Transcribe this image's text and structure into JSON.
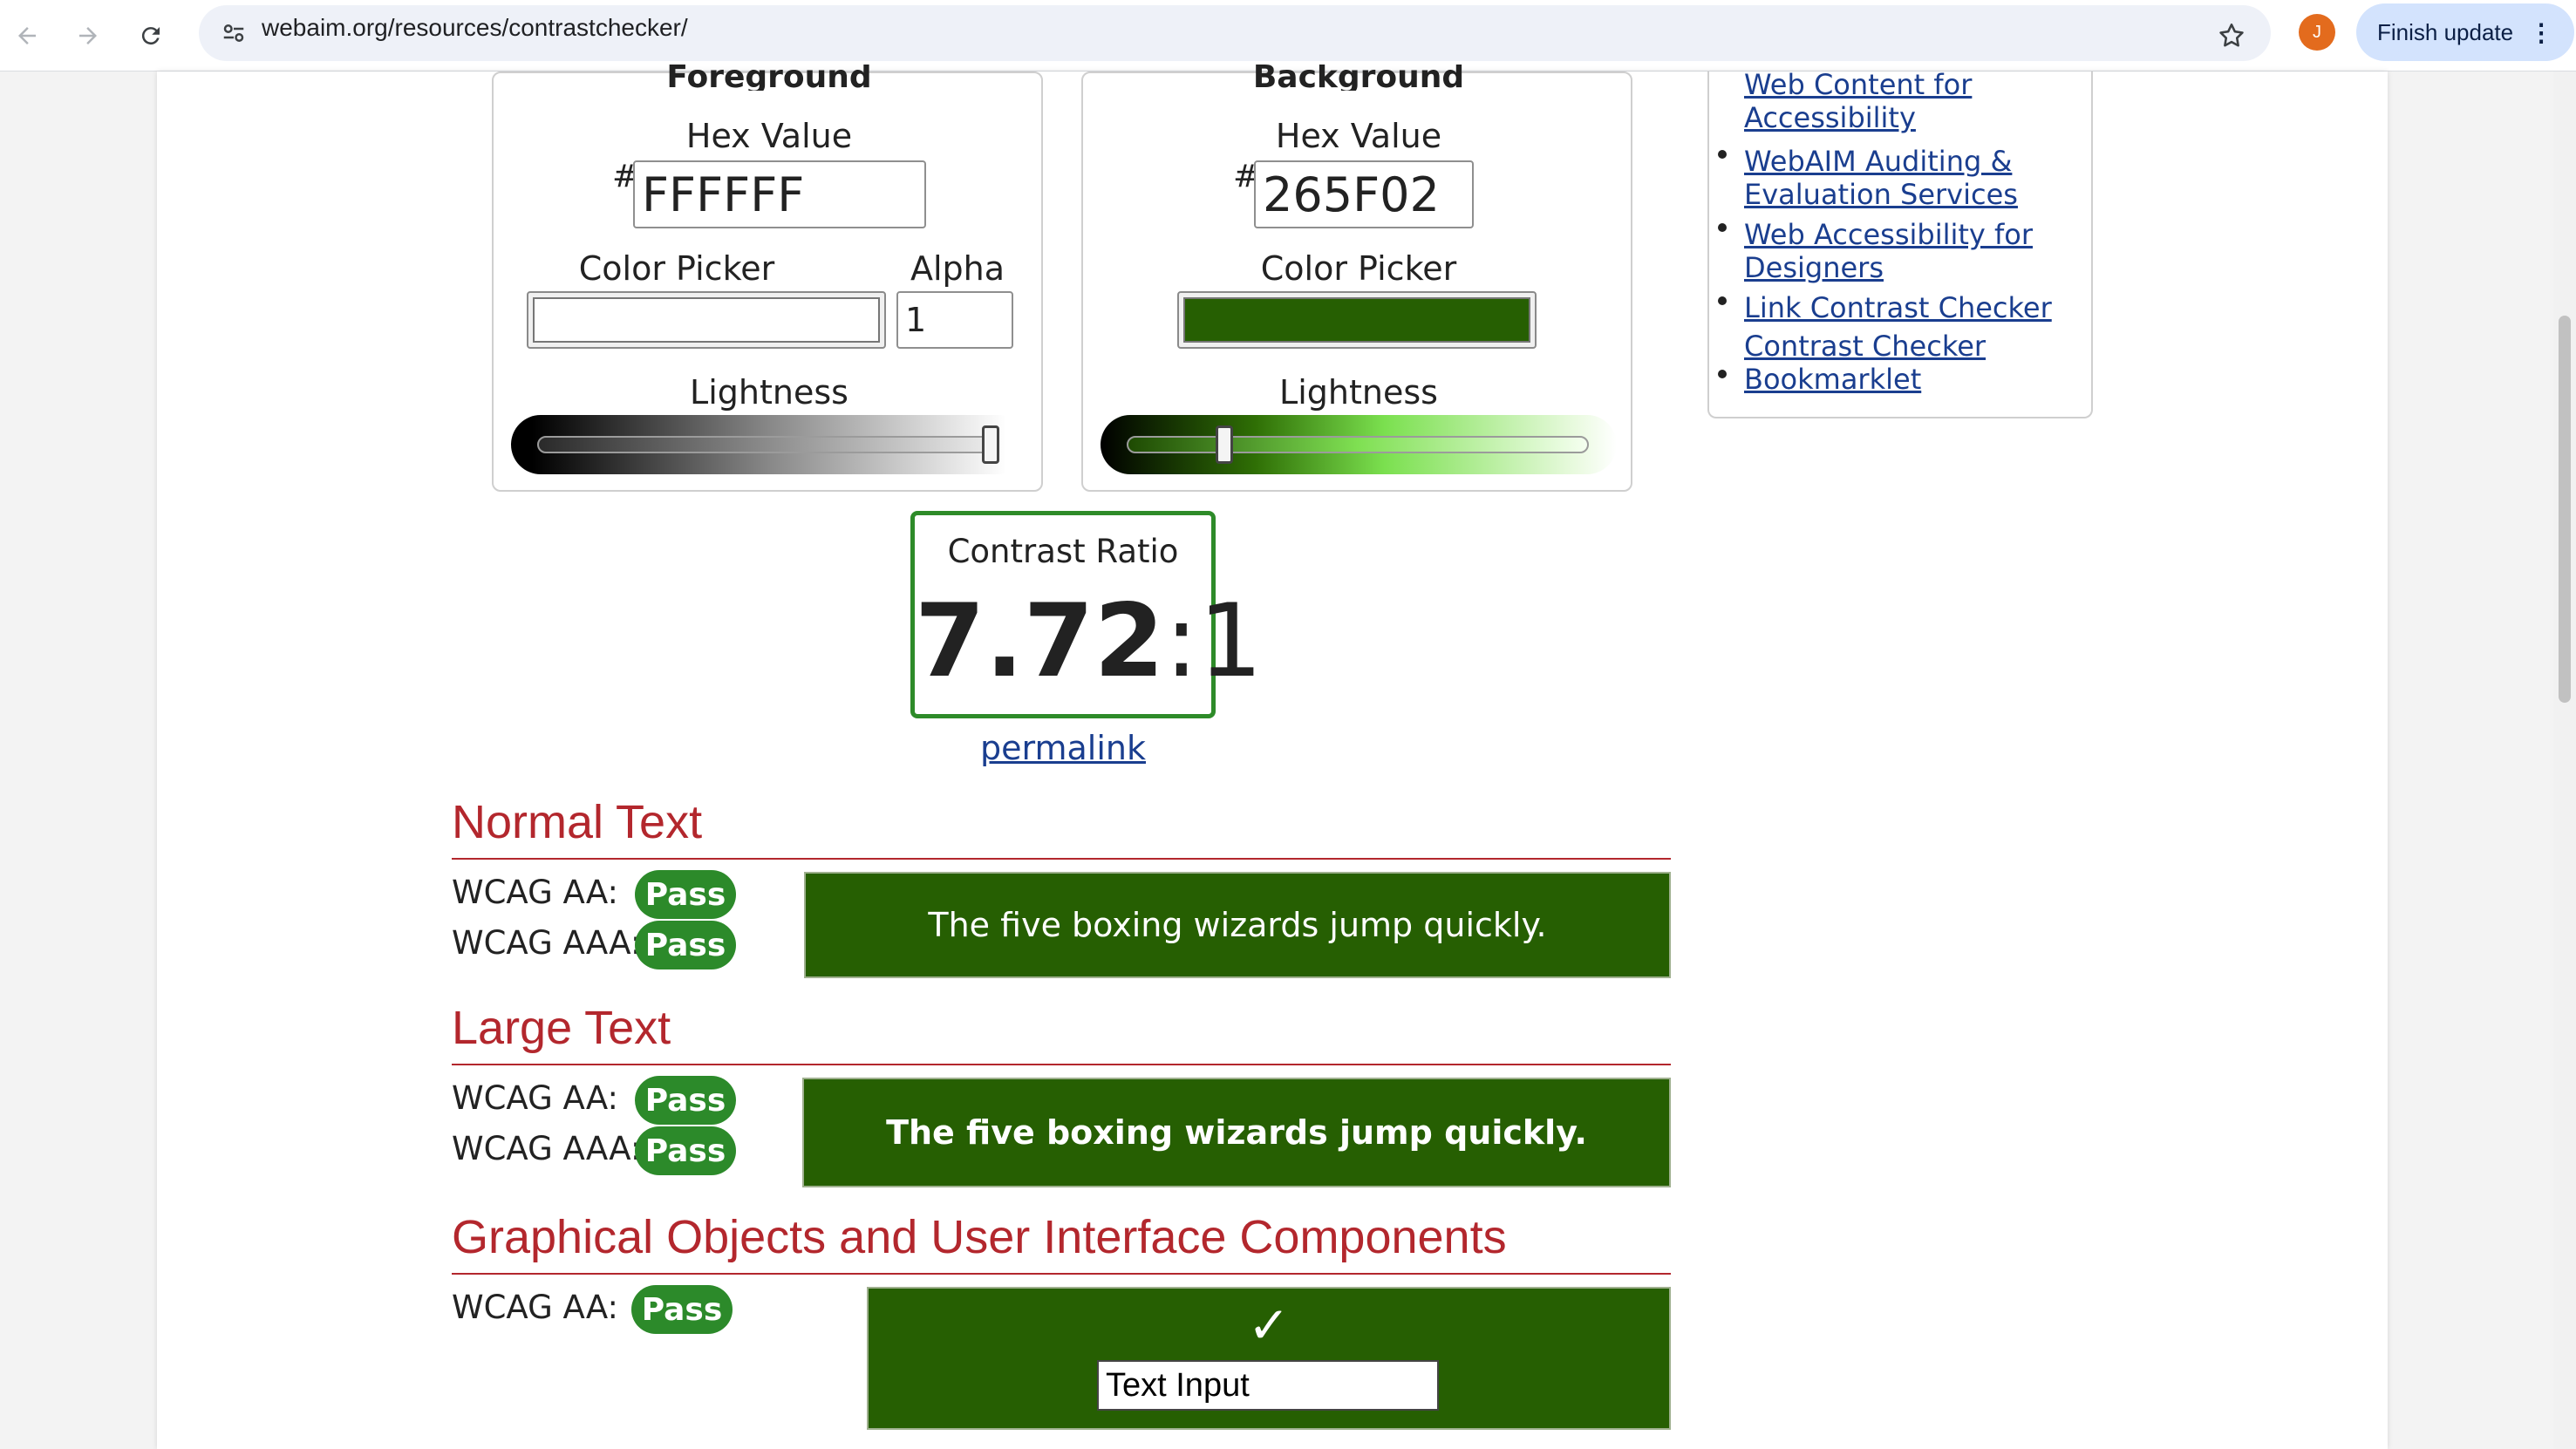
{
  "browser": {
    "url": "webaim.org/resources/contrastchecker/",
    "finish_update_label": "Finish update",
    "avatar_letter": "J"
  },
  "foreground": {
    "heading": "Foreground",
    "hex_label": "Hex Value",
    "hash": "#",
    "hex_value": "FFFFFF",
    "color_picker_label": "Color Picker",
    "alpha_label": "Alpha",
    "alpha_value": "1",
    "lightness_label": "Lightness",
    "color": "#FFFFFF",
    "lightness_level": 1.0
  },
  "background": {
    "heading": "Background",
    "hex_label": "Hex Value",
    "hash": "#",
    "hex_value": "265F02",
    "color_picker_label": "Color Picker",
    "lightness_label": "Lightness",
    "color": "#265F02",
    "lightness_level": 0.2
  },
  "sidebar": {
    "links": [
      "Web Content for Accessibility",
      "WebAIM Auditing & Evaluation Services",
      "Web Accessibility for Designers",
      "Link Contrast Checker",
      "Contrast Checker Bookmarklet"
    ]
  },
  "contrast": {
    "label": "Contrast Ratio",
    "ratio_main": "7.72",
    "ratio_suffix": ":1",
    "permalink": "permalink"
  },
  "normal_text": {
    "heading": "Normal Text",
    "aa_label": "WCAG AA:",
    "aa_result": "Pass",
    "aaa_label": "WCAG AAA:",
    "aaa_result": "Pass",
    "sample": "The five boxing wizards jump quickly."
  },
  "large_text": {
    "heading": "Large Text",
    "aa_label": "WCAG AA:",
    "aa_result": "Pass",
    "aaa_label": "WCAG AAA:",
    "aaa_result": "Pass",
    "sample": "The five boxing wizards jump quickly."
  },
  "graphical": {
    "heading": "Graphical Objects and User Interface Components",
    "aa_label": "WCAG AA:",
    "aa_result": "Pass",
    "checkmark": "✓",
    "text_input_value": "Text Input"
  },
  "colors": {
    "pass_green": "#2C8A2A",
    "heading_red": "#B3272D",
    "link_blue": "#1A3E8F"
  }
}
